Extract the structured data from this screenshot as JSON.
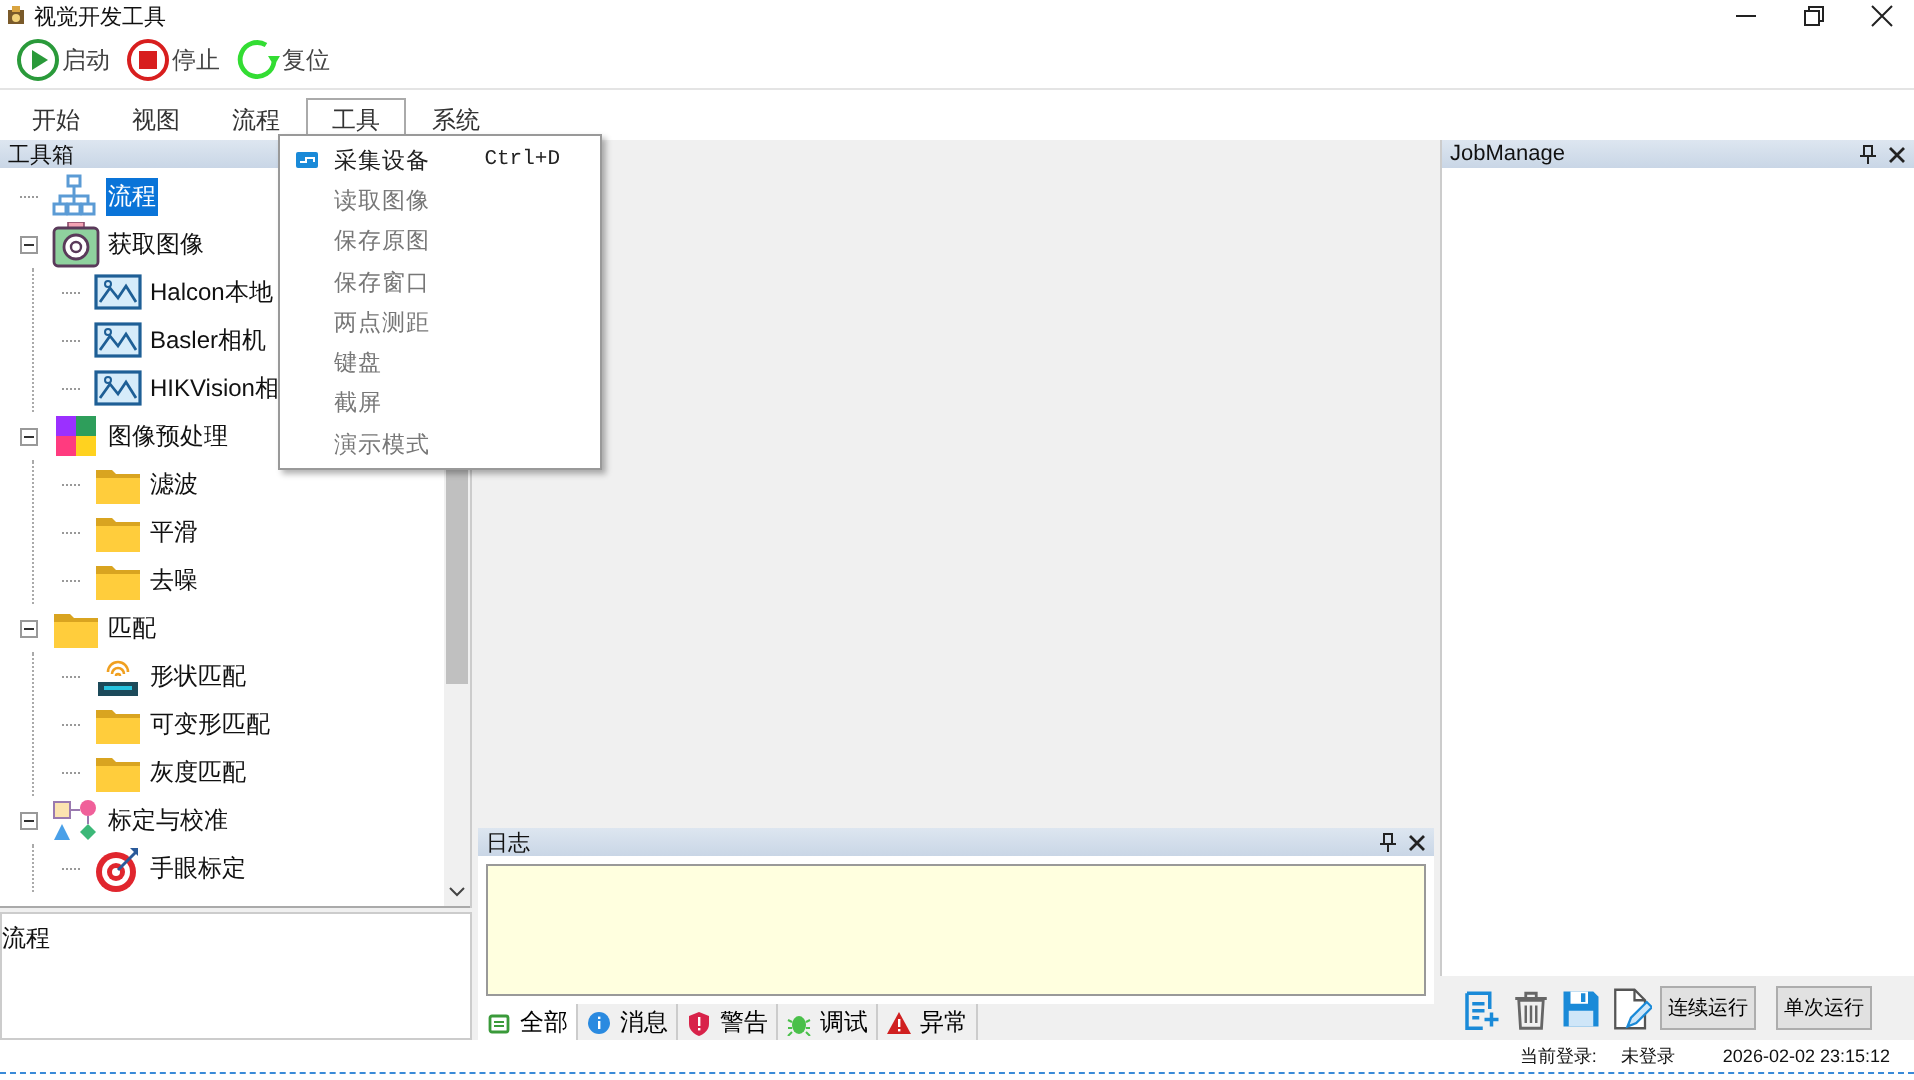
{
  "window": {
    "title": "视觉开发工具"
  },
  "toolbar": [
    {
      "kind": "start",
      "label": "启动"
    },
    {
      "kind": "stop",
      "label": "停止"
    },
    {
      "kind": "reset",
      "label": "复位"
    }
  ],
  "menu_tabs": [
    {
      "label": "开始",
      "selected": false
    },
    {
      "label": "视图",
      "selected": false
    },
    {
      "label": "流程",
      "selected": false
    },
    {
      "label": "工具",
      "selected": true
    },
    {
      "label": "系统",
      "selected": false
    }
  ],
  "dropdown": [
    {
      "label": "采集设备",
      "shortcut": "Ctrl+D",
      "disabled": false,
      "kind": "device"
    },
    {
      "label": "读取图像",
      "disabled": true
    },
    {
      "label": "保存原图",
      "disabled": true
    },
    {
      "label": "保存窗口",
      "disabled": true
    },
    {
      "label": "两点测距",
      "disabled": true
    },
    {
      "label": "键盘",
      "disabled": true
    },
    {
      "label": "截屏",
      "disabled": true
    },
    {
      "label": "演示模式",
      "disabled": true
    }
  ],
  "toolbox": {
    "title": "工具箱",
    "tree": [
      {
        "label": "流程",
        "kind": "flow",
        "selected": true
      },
      {
        "label": "获取图像",
        "kind": "camera",
        "selected": false,
        "expanded": true,
        "children": [
          {
            "label": "Halcon本地",
            "kind": "image",
            "selected": false
          },
          {
            "label": "Basler相机",
            "kind": "image",
            "selected": false
          },
          {
            "label": "HIKVision相",
            "kind": "image",
            "selected": false
          }
        ]
      },
      {
        "label": "图像预处理",
        "kind": "palette",
        "selected": false,
        "expanded": true,
        "children": [
          {
            "label": "滤波",
            "kind": "folder",
            "selected": false
          },
          {
            "label": "平滑",
            "kind": "folder",
            "selected": false
          },
          {
            "label": "去噪",
            "kind": "folder",
            "selected": false
          }
        ]
      },
      {
        "label": "匹配",
        "kind": "folder",
        "selected": false,
        "expanded": true,
        "children": [
          {
            "label": "形状匹配",
            "kind": "match",
            "selected": false
          },
          {
            "label": "可变形匹配",
            "kind": "folder",
            "selected": false
          },
          {
            "label": "灰度匹配",
            "kind": "folder",
            "selected": false
          }
        ]
      },
      {
        "label": "标定与校准",
        "kind": "shapes",
        "selected": false,
        "expanded": true,
        "children": [
          {
            "label": "手眼标定",
            "kind": "target",
            "selected": false
          }
        ]
      }
    ]
  },
  "flow_panel": {
    "text": "流程"
  },
  "log": {
    "title": "日志",
    "tabs": [
      {
        "label": "全部",
        "kind": "all",
        "selected": true
      },
      {
        "label": "消息",
        "kind": "info",
        "selected": false
      },
      {
        "label": "警告",
        "kind": "warning",
        "selected": false
      },
      {
        "label": "调试",
        "kind": "debug",
        "selected": false
      },
      {
        "label": "异常",
        "kind": "error",
        "selected": false
      }
    ]
  },
  "job_manage": {
    "title": "JobManage",
    "tools": [
      {
        "kind": "new"
      },
      {
        "kind": "delete"
      },
      {
        "kind": "save"
      },
      {
        "kind": "edit"
      }
    ],
    "buttons": [
      "连续运行",
      "单次运行"
    ]
  },
  "status_bar": {
    "login_label": "当前登录:",
    "login_value": "未登录",
    "time": "2026-02-02 23:15:12"
  }
}
